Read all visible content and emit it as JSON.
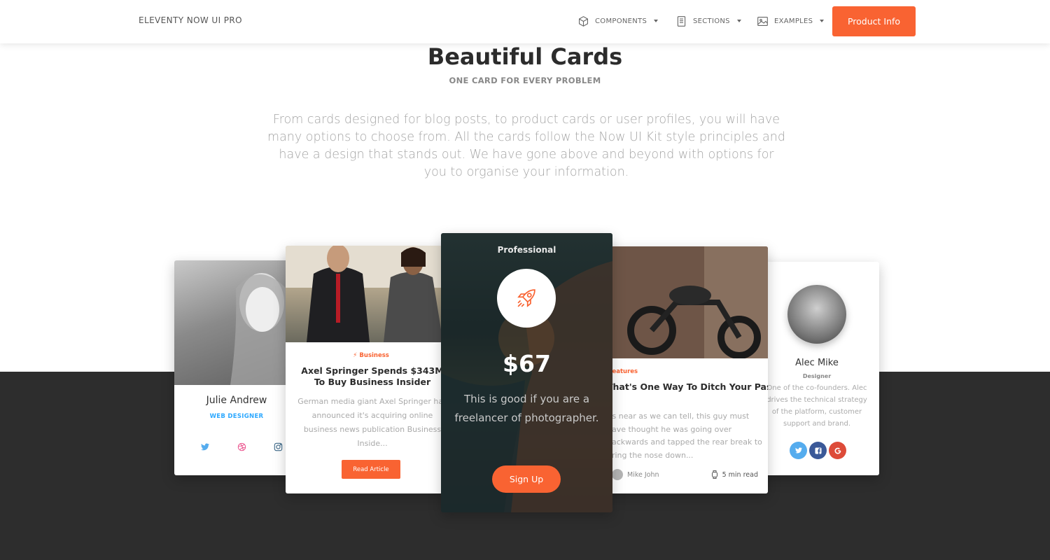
{
  "navbar": {
    "brand": "ELEVENTY NOW UI PRO",
    "items": [
      {
        "label": "COMPONENTS",
        "icon": "box-icon"
      },
      {
        "label": "SECTIONS",
        "icon": "document-icon"
      },
      {
        "label": "EXAMPLES",
        "icon": "image-icon"
      }
    ],
    "cta": "Product Info"
  },
  "header": {
    "title": "Beautiful Cards",
    "subtitle": "ONE CARD FOR EVERY PROBLEM",
    "description": "From cards designed for blog posts, to product cards or user profiles, you will have many options to choose from. All the cards follow the Now UI Kit style principles and have a design that stands out. We have gone above and beyond with options for you to organise your information."
  },
  "cards": {
    "profile_left": {
      "name": "Julie Andrew",
      "role": "WEB DESIGNER",
      "social": [
        "twitter-icon",
        "dribbble-icon",
        "instagram-icon"
      ]
    },
    "blog": {
      "category": "Business",
      "title": "Axel Springer Spends $343M To Buy Business Insider",
      "text": "German media giant Axel Springer has announced it's acquiring online business news publication Business Inside...",
      "button": "Read Article"
    },
    "pricing": {
      "category": "Professional",
      "price": "$67",
      "description": "This is good if you are a freelancer of photographer.",
      "button": "Sign Up"
    },
    "feature": {
      "category": "Features",
      "title": "That's One Way To Ditch Your Passenger",
      "text": "As near as we can tell, this guy must have thought he was going over backwards and tapped the rear break to bring the nose down...",
      "author": "Mike John",
      "read_time": "5 min read"
    },
    "profile_right": {
      "name": "Alec Mike",
      "role": "Designer",
      "text": "One of the co-founders. Alec drives the technical strategy of the platform, customer support and brand.",
      "social": [
        {
          "icon": "twitter-icon",
          "color": "#55acee"
        },
        {
          "icon": "facebook-icon",
          "color": "#3b5998"
        },
        {
          "icon": "google-icon",
          "color": "#dd4b39"
        }
      ]
    }
  },
  "colors": {
    "accent": "#f96332",
    "info": "#2ca8ff",
    "dark_section": "#2d2d2d"
  }
}
